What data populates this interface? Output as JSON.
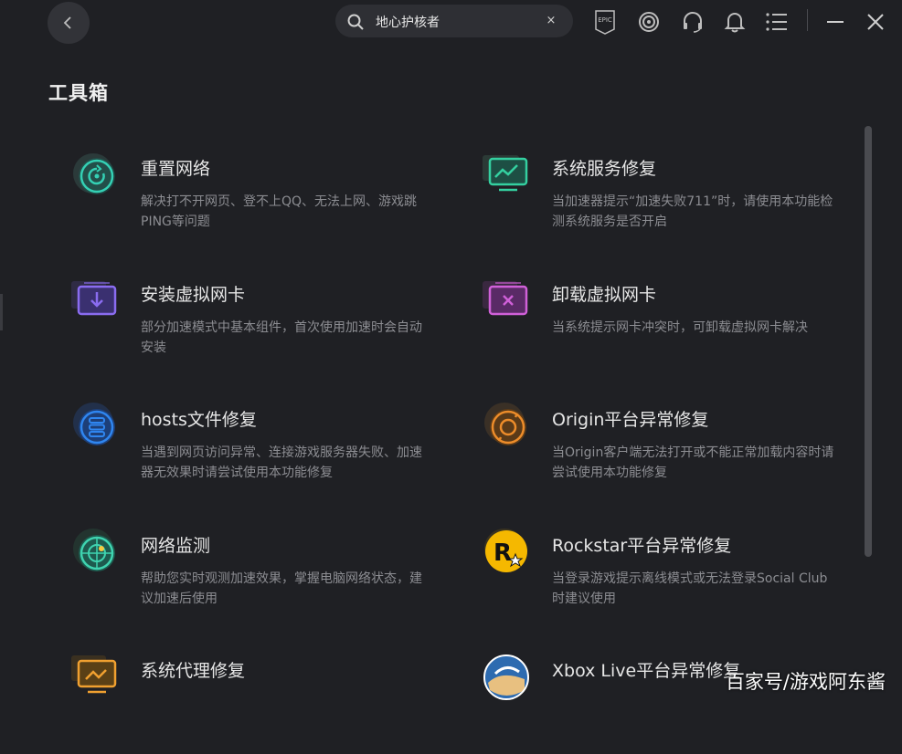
{
  "header": {
    "search_value": "地心护核者",
    "clear_symbol": "×",
    "epic_label": "EPIC"
  },
  "page": {
    "title": "工具箱"
  },
  "tools": [
    {
      "name": "重置网络",
      "desc": "解决打不开网页、登不上QQ、无法上网、游戏跳PING等问题",
      "icon": "reset-network-icon"
    },
    {
      "name": "系统服务修复",
      "desc": "当加速器提示“加速失败711”时，请使用本功能检测系统服务是否开启",
      "icon": "system-service-icon"
    },
    {
      "name": "安装虚拟网卡",
      "desc": "部分加速模式中基本组件，首次使用加速时会自动安装",
      "icon": "install-nic-icon"
    },
    {
      "name": "卸载虚拟网卡",
      "desc": "当系统提示网卡冲突时，可卸载虚拟网卡解决",
      "icon": "uninstall-nic-icon"
    },
    {
      "name": "hosts文件修复",
      "desc": "当遇到网页访问异常、连接游戏服务器失败、加速器无效果时请尝试使用本功能修复",
      "icon": "hosts-icon"
    },
    {
      "name": "Origin平台异常修复",
      "desc": "当Origin客户端无法打开或不能正常加载内容时请尝试使用本功能修复",
      "icon": "origin-icon"
    },
    {
      "name": "网络监测",
      "desc": "帮助您实时观测加速效果，掌握电脑网络状态，建议加速后使用",
      "icon": "radar-icon"
    },
    {
      "name": "Rockstar平台异常修复",
      "desc": "当登录游戏提示离线模式或无法登录Social Club时建议使用",
      "icon": "rockstar-icon"
    },
    {
      "name": "系统代理修复",
      "desc": "",
      "icon": "proxy-icon"
    },
    {
      "name": "Xbox Live平台异常修复",
      "desc": "",
      "icon": "xbox-live-icon"
    }
  ],
  "watermark": "百家号/游戏阿东酱",
  "colors": {
    "background": "#1f2024",
    "teal": "#2fbfa8",
    "purple": "#7d62d6",
    "pink": "#c255c8",
    "blue": "#2c7be5",
    "orange": "#e08a2b",
    "yellow": "#f5b800"
  }
}
